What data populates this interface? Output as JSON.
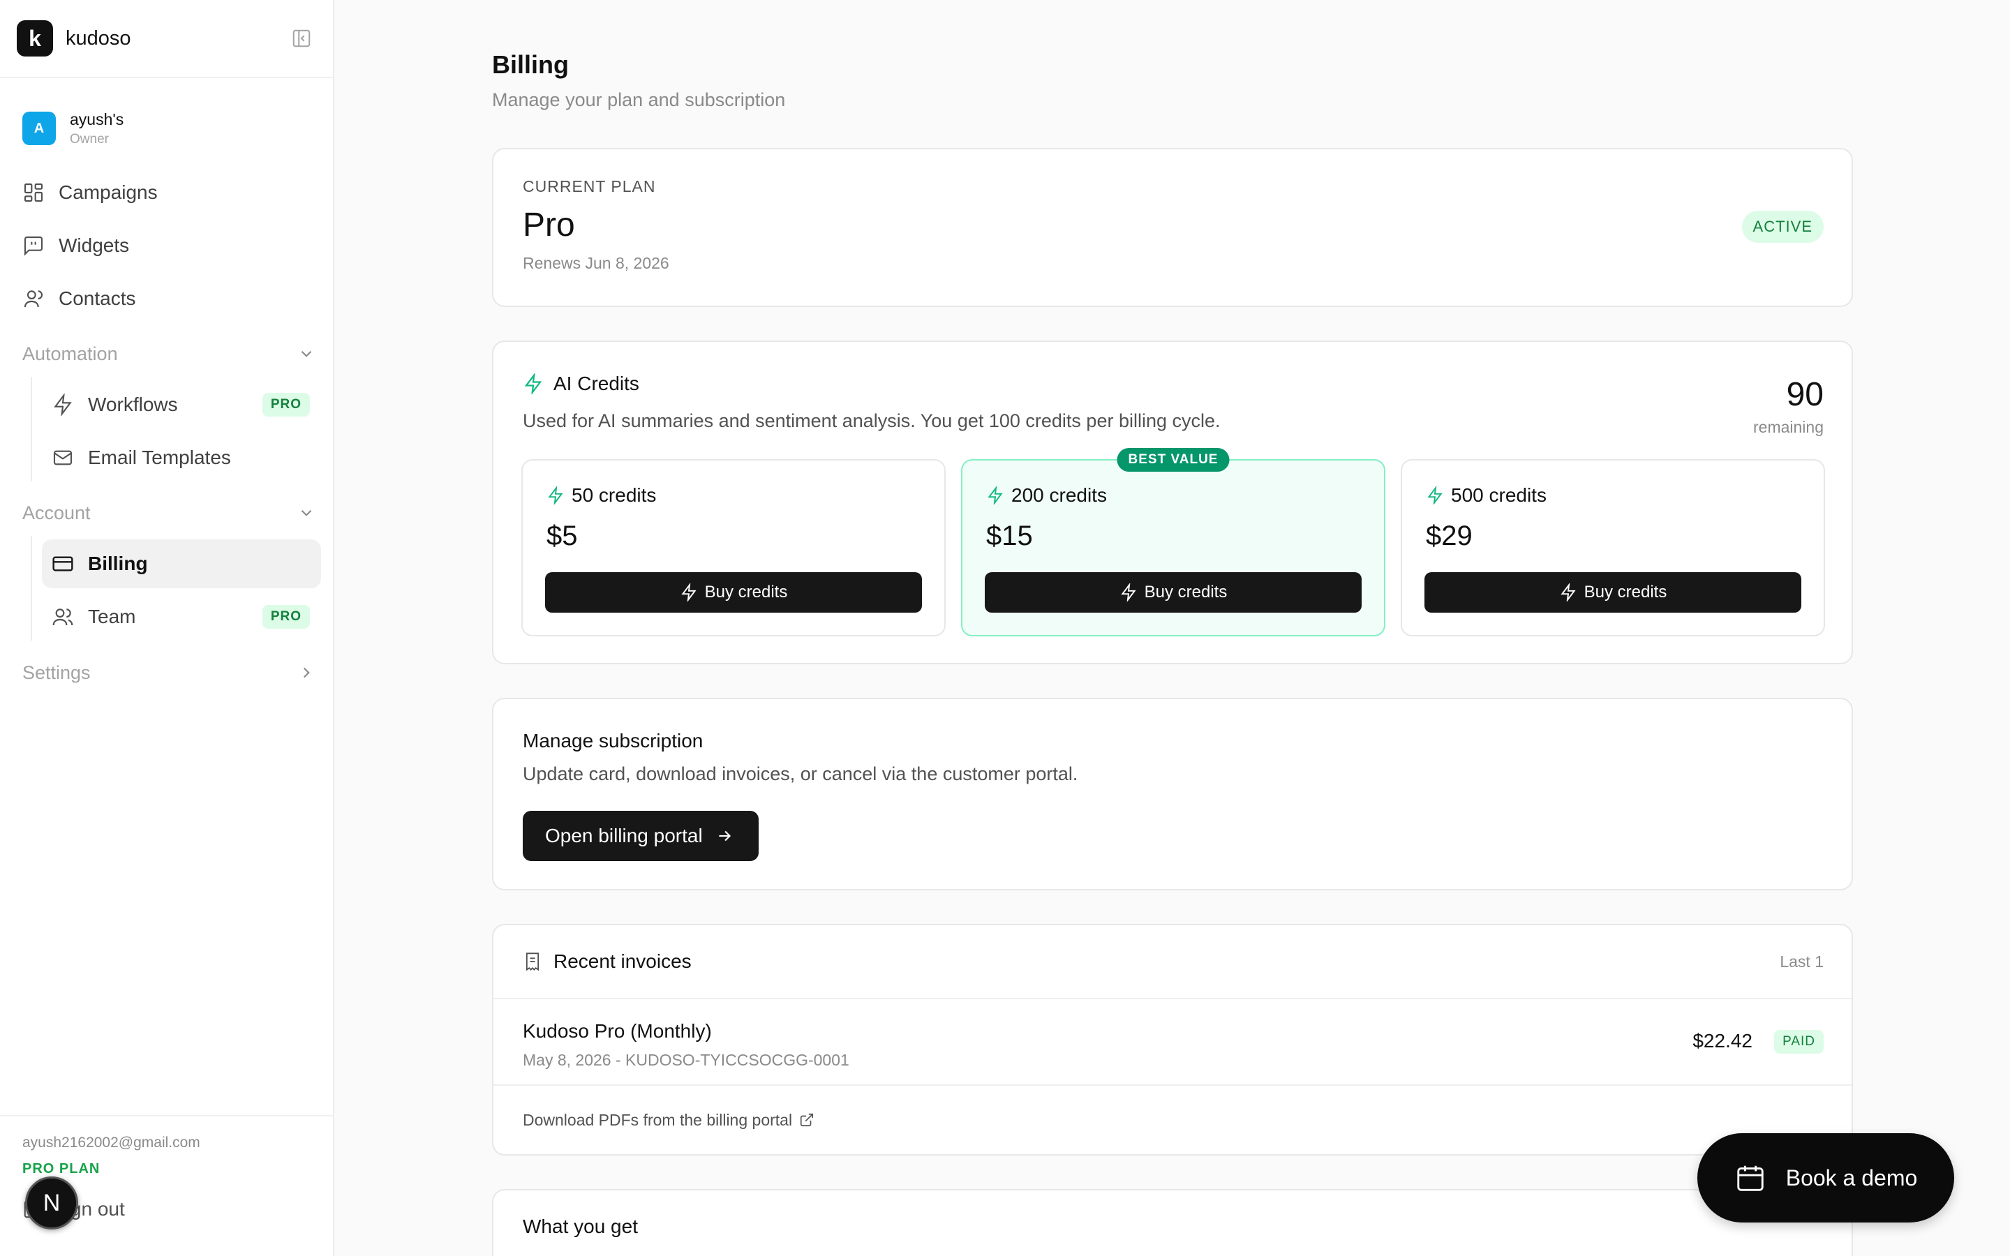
{
  "brand": {
    "logo_letter": "k",
    "name": "kudoso"
  },
  "workspace": {
    "avatar_letter": "A",
    "name": "ayush's",
    "role": "Owner"
  },
  "nav": {
    "campaigns": "Campaigns",
    "widgets": "Widgets",
    "contacts": "Contacts",
    "automation_section": "Automation",
    "workflows": "Workflows",
    "workflows_badge": "PRO",
    "email_templates": "Email Templates",
    "account_section": "Account",
    "billing": "Billing",
    "team": "Team",
    "team_badge": "PRO",
    "settings_section": "Settings"
  },
  "user": {
    "email": "ayush2162002@gmail.com",
    "plan": "PRO PLAN",
    "signout": "Sign out",
    "avatar_letter": "N"
  },
  "page": {
    "title": "Billing",
    "subtitle": "Manage your plan and subscription"
  },
  "plan": {
    "eyebrow": "CURRENT PLAN",
    "name": "Pro",
    "renews": "Renews Jun 8, 2026",
    "status": "ACTIVE"
  },
  "credits": {
    "title": "AI Credits",
    "description": "Used for AI summaries and sentiment analysis. You get 100 credits per billing cycle.",
    "remaining": "90",
    "remaining_label": "remaining",
    "packs": [
      {
        "credits": "50 credits",
        "price": "$5",
        "button": "Buy credits"
      },
      {
        "credits": "200 credits",
        "price": "$15",
        "button": "Buy credits",
        "tag": "BEST VALUE"
      },
      {
        "credits": "500 credits",
        "price": "$29",
        "button": "Buy credits"
      }
    ]
  },
  "subscription": {
    "title": "Manage subscription",
    "description": "Update card, download invoices, or cancel via the customer portal.",
    "button": "Open billing portal"
  },
  "invoices": {
    "title": "Recent invoices",
    "range": "Last 1",
    "rows": [
      {
        "name": "Kudoso Pro (Monthly)",
        "meta": "May 8, 2026 - KUDOSO-TYICCSOCGG-0001",
        "amount": "$22.42",
        "status": "PAID"
      }
    ],
    "footer": "Download PDFs from the billing portal"
  },
  "benefits": {
    "title": "What you get"
  },
  "demo": {
    "label": "Book a demo"
  },
  "colors": {
    "accent_green": "#16a34a",
    "badge_bg": "#dcfce7",
    "dark_button": "#171717",
    "workspace_avatar": "#0ea5e9"
  }
}
